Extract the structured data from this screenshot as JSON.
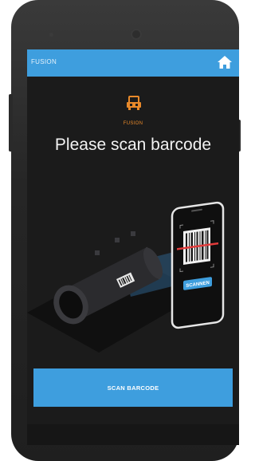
{
  "appbar": {
    "title": "FUSION",
    "home_icon": "home-icon",
    "color": "#3e9ede"
  },
  "logo": {
    "icon": "fusion-machine-icon",
    "label": "FUSION",
    "color": "#e8892a"
  },
  "main": {
    "heading": "Please scan barcode",
    "illustration": {
      "phone_label": "SCANNEN"
    }
  },
  "actions": {
    "scan_label": "SCAN BARCODE"
  }
}
